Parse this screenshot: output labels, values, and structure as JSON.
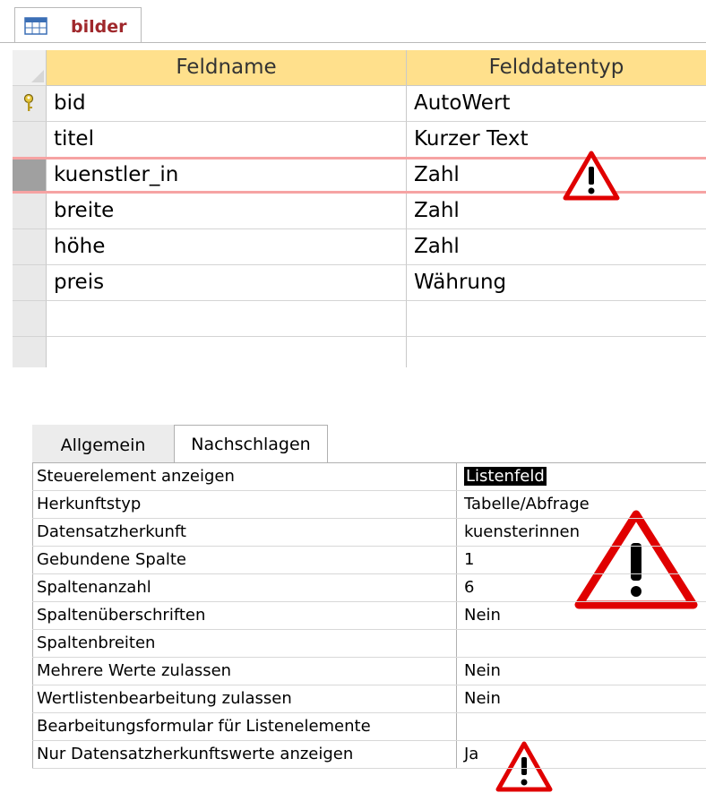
{
  "document_tab": {
    "label": "bilder"
  },
  "grid": {
    "headers": {
      "field_name": "Feldname",
      "data_type": "Felddatentyp"
    },
    "rows": [
      {
        "field": "bid",
        "type": "AutoWert",
        "primary_key": true
      },
      {
        "field": "titel",
        "type": "Kurzer Text"
      },
      {
        "field": "kuenstler_in",
        "type": "Zahl",
        "selected": true
      },
      {
        "field": "breite",
        "type": "Zahl"
      },
      {
        "field": "höhe",
        "type": "Zahl"
      },
      {
        "field": "preis",
        "type": "Währung"
      },
      {
        "field": "",
        "type": ""
      },
      {
        "field": "",
        "type": ""
      }
    ]
  },
  "property_tabs": {
    "general": "Allgemein",
    "lookup": "Nachschlagen"
  },
  "properties": [
    {
      "name": "Steuerelement anzeigen",
      "value": "Listenfeld"
    },
    {
      "name": "Herkunftstyp",
      "value": "Tabelle/Abfrage"
    },
    {
      "name": "Datensatzherkunft",
      "value": "kuensterinnen"
    },
    {
      "name": "Gebundene Spalte",
      "value": "1"
    },
    {
      "name": "Spaltenanzahl",
      "value": "6"
    },
    {
      "name": "Spaltenüberschriften",
      "value": "Nein"
    },
    {
      "name": "Spaltenbreiten",
      "value": ""
    },
    {
      "name": "Mehrere Werte zulassen",
      "value": "Nein"
    },
    {
      "name": "Wertlistenbearbeitung zulassen",
      "value": "Nein"
    },
    {
      "name": "Bearbeitungsformular für Listenelemente",
      "value": ""
    },
    {
      "name": "Nur Datensatzherkunftswerte anzeigen",
      "value": "Ja"
    }
  ],
  "colors": {
    "header": "#ffe08c",
    "highlight": "#f6a3a3",
    "warning": "#e00000",
    "tab_label": "#a0282c"
  },
  "icons": [
    "table-icon",
    "primary-key-icon",
    "warning-icon"
  ]
}
